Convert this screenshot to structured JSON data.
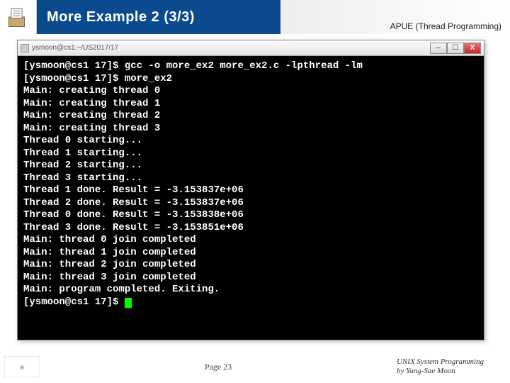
{
  "header": {
    "title": "More Example 2 (3/3)",
    "subtitle": "APUE (Thread Programming)"
  },
  "window": {
    "title": "ysmoon@cs1:~/US2017/17",
    "buttons": {
      "min": "–",
      "max": "☐",
      "close": "X"
    }
  },
  "terminal": {
    "lines": [
      "[ysmoon@cs1 17]$ gcc -o more_ex2 more_ex2.c -lpthread -lm",
      "[ysmoon@cs1 17]$ more_ex2",
      "Main: creating thread 0",
      "Main: creating thread 1",
      "Main: creating thread 2",
      "Main: creating thread 3",
      "Thread 0 starting...",
      "Thread 1 starting...",
      "Thread 2 starting...",
      "Thread 3 starting...",
      "Thread 1 done. Result = -3.153837e+06",
      "Thread 2 done. Result = -3.153837e+06",
      "Thread 0 done. Result = -3.153838e+06",
      "Thread 3 done. Result = -3.153851e+06",
      "Main: thread 0 join completed",
      "Main: thread 1 join completed",
      "Main: thread 2 join completed",
      "Main: thread 3 join completed",
      "Main: program completed. Exiting.",
      "[ysmoon@cs1 17]$ "
    ]
  },
  "footer": {
    "page": "Page 23",
    "right1": "UNIX System Programming",
    "right2": "by Yang-Sae Moon"
  }
}
